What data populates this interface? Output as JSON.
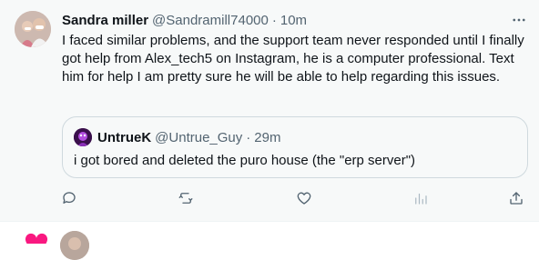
{
  "tweet": {
    "author_name": "Sandra miller",
    "author_handle": "@Sandramill74000",
    "separator": "·",
    "time": "10m",
    "text": "I faced similar problems, and the support team never responded until I finally got help from Alex_tech5 on Instagram, he is a computer professional. Text him for help I am pretty sure he will be able to help regarding this issues."
  },
  "quoted_tweet": {
    "author_name": "UntrueK",
    "author_handle": "@Untrue_Guy",
    "separator": "·",
    "time": "29m",
    "text": "i got bored and deleted the puro house (the \"erp server\")"
  },
  "actions": {
    "reply_icon": "reply-icon",
    "retweet_icon": "retweet-icon",
    "like_icon": "heart-icon",
    "views_icon": "views-icon",
    "share_icon": "share-icon"
  },
  "colors": {
    "background": "#f7f9f9",
    "text": "#0f1419",
    "muted": "#536471",
    "border": "#cfd9de",
    "accent_like": "#f91880"
  }
}
